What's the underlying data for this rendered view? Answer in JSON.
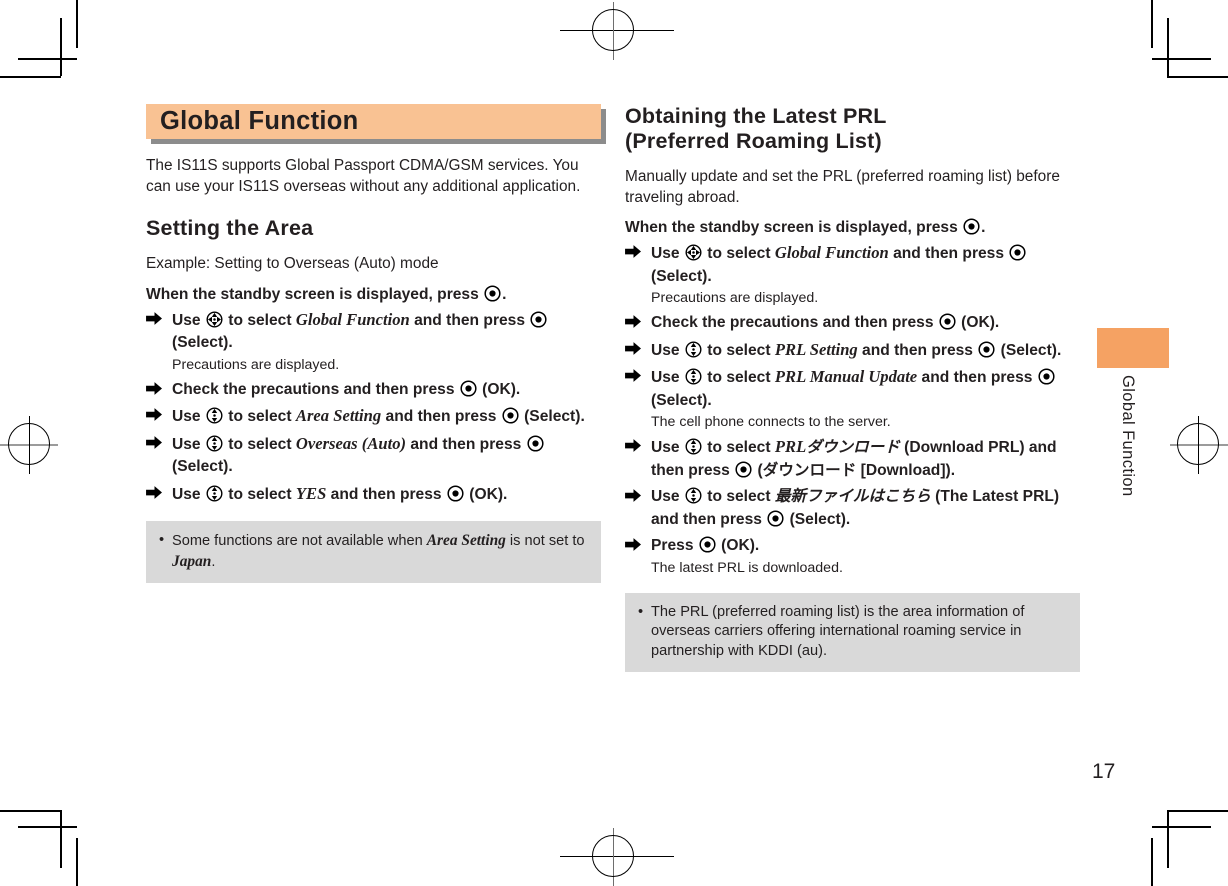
{
  "page": {
    "number": "17",
    "side_tab_label": "Global Function"
  },
  "left_column": {
    "chapter_title": "Global Function",
    "intro": "The IS11S supports Global Passport CDMA/GSM services. You can use your IS11S overseas without any additional application.",
    "section_heading": "Setting the Area",
    "example_line": "Example: Setting to Overseas (Auto) mode",
    "lead_line_pre": "When the standby screen is displayed, press",
    "lead_line_post": ".",
    "steps": [
      {
        "segments": [
          {
            "t": "Use ",
            "style": "bold"
          },
          {
            "t": "",
            "style": "key-4way"
          },
          {
            "t": " to select ",
            "style": "bold"
          },
          {
            "t": "Global Function",
            "style": "italic"
          },
          {
            "t": " and then press ",
            "style": "bold"
          },
          {
            "t": "",
            "style": "key-select"
          },
          {
            "t": " (Select).",
            "style": "bold"
          }
        ],
        "note": "Precautions are displayed."
      },
      {
        "segments": [
          {
            "t": "Check the precautions and then press ",
            "style": "bold"
          },
          {
            "t": "",
            "style": "key-select"
          },
          {
            "t": " (OK).",
            "style": "bold"
          }
        ],
        "note": ""
      },
      {
        "segments": [
          {
            "t": "Use ",
            "style": "bold"
          },
          {
            "t": "",
            "style": "key-updown"
          },
          {
            "t": " to select ",
            "style": "bold"
          },
          {
            "t": "Area Setting",
            "style": "italic"
          },
          {
            "t": " and then press ",
            "style": "bold"
          },
          {
            "t": "",
            "style": "key-select"
          },
          {
            "t": " (Select).",
            "style": "bold"
          }
        ],
        "note": ""
      },
      {
        "segments": [
          {
            "t": "Use ",
            "style": "bold"
          },
          {
            "t": "",
            "style": "key-updown"
          },
          {
            "t": " to select ",
            "style": "bold"
          },
          {
            "t": "Overseas (Auto)",
            "style": "italic"
          },
          {
            "t": " and then press ",
            "style": "bold"
          },
          {
            "t": "",
            "style": "key-select"
          },
          {
            "t": " (Select).",
            "style": "bold"
          }
        ],
        "note": ""
      },
      {
        "segments": [
          {
            "t": "Use ",
            "style": "bold"
          },
          {
            "t": "",
            "style": "key-updown"
          },
          {
            "t": " to select ",
            "style": "bold"
          },
          {
            "t": "YES",
            "style": "italic"
          },
          {
            "t": " and then press ",
            "style": "bold"
          },
          {
            "t": "",
            "style": "key-select"
          },
          {
            "t": " (OK).",
            "style": "bold"
          }
        ],
        "note": ""
      }
    ],
    "note_box": [
      {
        "segments": [
          {
            "t": "Some functions are not available when ",
            "style": "plain"
          },
          {
            "t": "Area Setting",
            "style": "italic"
          },
          {
            "t": " is not set to ",
            "style": "plain"
          },
          {
            "t": "Japan",
            "style": "italic"
          },
          {
            "t": ".",
            "style": "plain"
          }
        ]
      }
    ]
  },
  "right_column": {
    "section_heading_line1": "Obtaining the Latest PRL",
    "section_heading_line2": "(Preferred Roaming List)",
    "intro": "Manually update and set the PRL (preferred roaming list) before traveling abroad.",
    "lead_line_pre": "When the standby screen is displayed, press",
    "lead_line_post": ".",
    "steps": [
      {
        "segments": [
          {
            "t": "Use ",
            "style": "bold"
          },
          {
            "t": "",
            "style": "key-4way"
          },
          {
            "t": " to select ",
            "style": "bold"
          },
          {
            "t": "Global Function",
            "style": "italic"
          },
          {
            "t": " and then press ",
            "style": "bold"
          },
          {
            "t": "",
            "style": "key-select"
          },
          {
            "t": " (Select).",
            "style": "bold"
          }
        ],
        "note": "Precautions are displayed."
      },
      {
        "segments": [
          {
            "t": "Check the precautions and then press ",
            "style": "bold"
          },
          {
            "t": "",
            "style": "key-select"
          },
          {
            "t": " (OK).",
            "style": "bold"
          }
        ],
        "note": ""
      },
      {
        "segments": [
          {
            "t": "Use ",
            "style": "bold"
          },
          {
            "t": "",
            "style": "key-updown"
          },
          {
            "t": " to select ",
            "style": "bold"
          },
          {
            "t": "PRL Setting",
            "style": "italic"
          },
          {
            "t": " and then press ",
            "style": "bold"
          },
          {
            "t": "",
            "style": "key-select"
          },
          {
            "t": " (Select).",
            "style": "bold"
          }
        ],
        "note": ""
      },
      {
        "segments": [
          {
            "t": "Use ",
            "style": "bold"
          },
          {
            "t": "",
            "style": "key-updown"
          },
          {
            "t": " to select ",
            "style": "bold"
          },
          {
            "t": "PRL Manual Update",
            "style": "italic"
          },
          {
            "t": " and then press ",
            "style": "bold"
          },
          {
            "t": "",
            "style": "key-select"
          },
          {
            "t": " (Select).",
            "style": "bold"
          }
        ],
        "note": "The cell phone connects to the server."
      },
      {
        "segments": [
          {
            "t": "Use ",
            "style": "bold"
          },
          {
            "t": "",
            "style": "key-updown"
          },
          {
            "t": " to select ",
            "style": "bold"
          },
          {
            "t": "PRL",
            "style": "italic"
          },
          {
            "t": "ダウンロード",
            "style": "jp"
          },
          {
            "t": " (Download PRL) and then press ",
            "style": "bold"
          },
          {
            "t": "",
            "style": "key-select"
          },
          {
            "t": " (ダウンロード [Download]).",
            "style": "bold"
          }
        ],
        "note": ""
      },
      {
        "segments": [
          {
            "t": "Use ",
            "style": "bold"
          },
          {
            "t": "",
            "style": "key-updown"
          },
          {
            "t": " to select ",
            "style": "bold"
          },
          {
            "t": "最新ファイルはこちら",
            "style": "jp"
          },
          {
            "t": " (The Latest PRL) and then press ",
            "style": "bold"
          },
          {
            "t": "",
            "style": "key-select"
          },
          {
            "t": " (Select).",
            "style": "bold"
          }
        ],
        "note": ""
      },
      {
        "segments": [
          {
            "t": "Press ",
            "style": "bold"
          },
          {
            "t": "",
            "style": "key-select"
          },
          {
            "t": " (OK).",
            "style": "bold"
          }
        ],
        "note": "The latest PRL is downloaded."
      }
    ],
    "note_box": [
      {
        "segments": [
          {
            "t": "The PRL (preferred roaming list) is the area information of overseas carriers offering international roaming service in partnership with KDDI (au).",
            "style": "plain"
          }
        ]
      }
    ]
  },
  "colors": {
    "title_bar_bg": "#f9c293",
    "title_bar_shadow": "#8c8c8c",
    "rule_orange": "#f2a15e",
    "side_tab": "#f5a263",
    "note_box_bg": "#d9d9d9",
    "text": "#231f20"
  }
}
